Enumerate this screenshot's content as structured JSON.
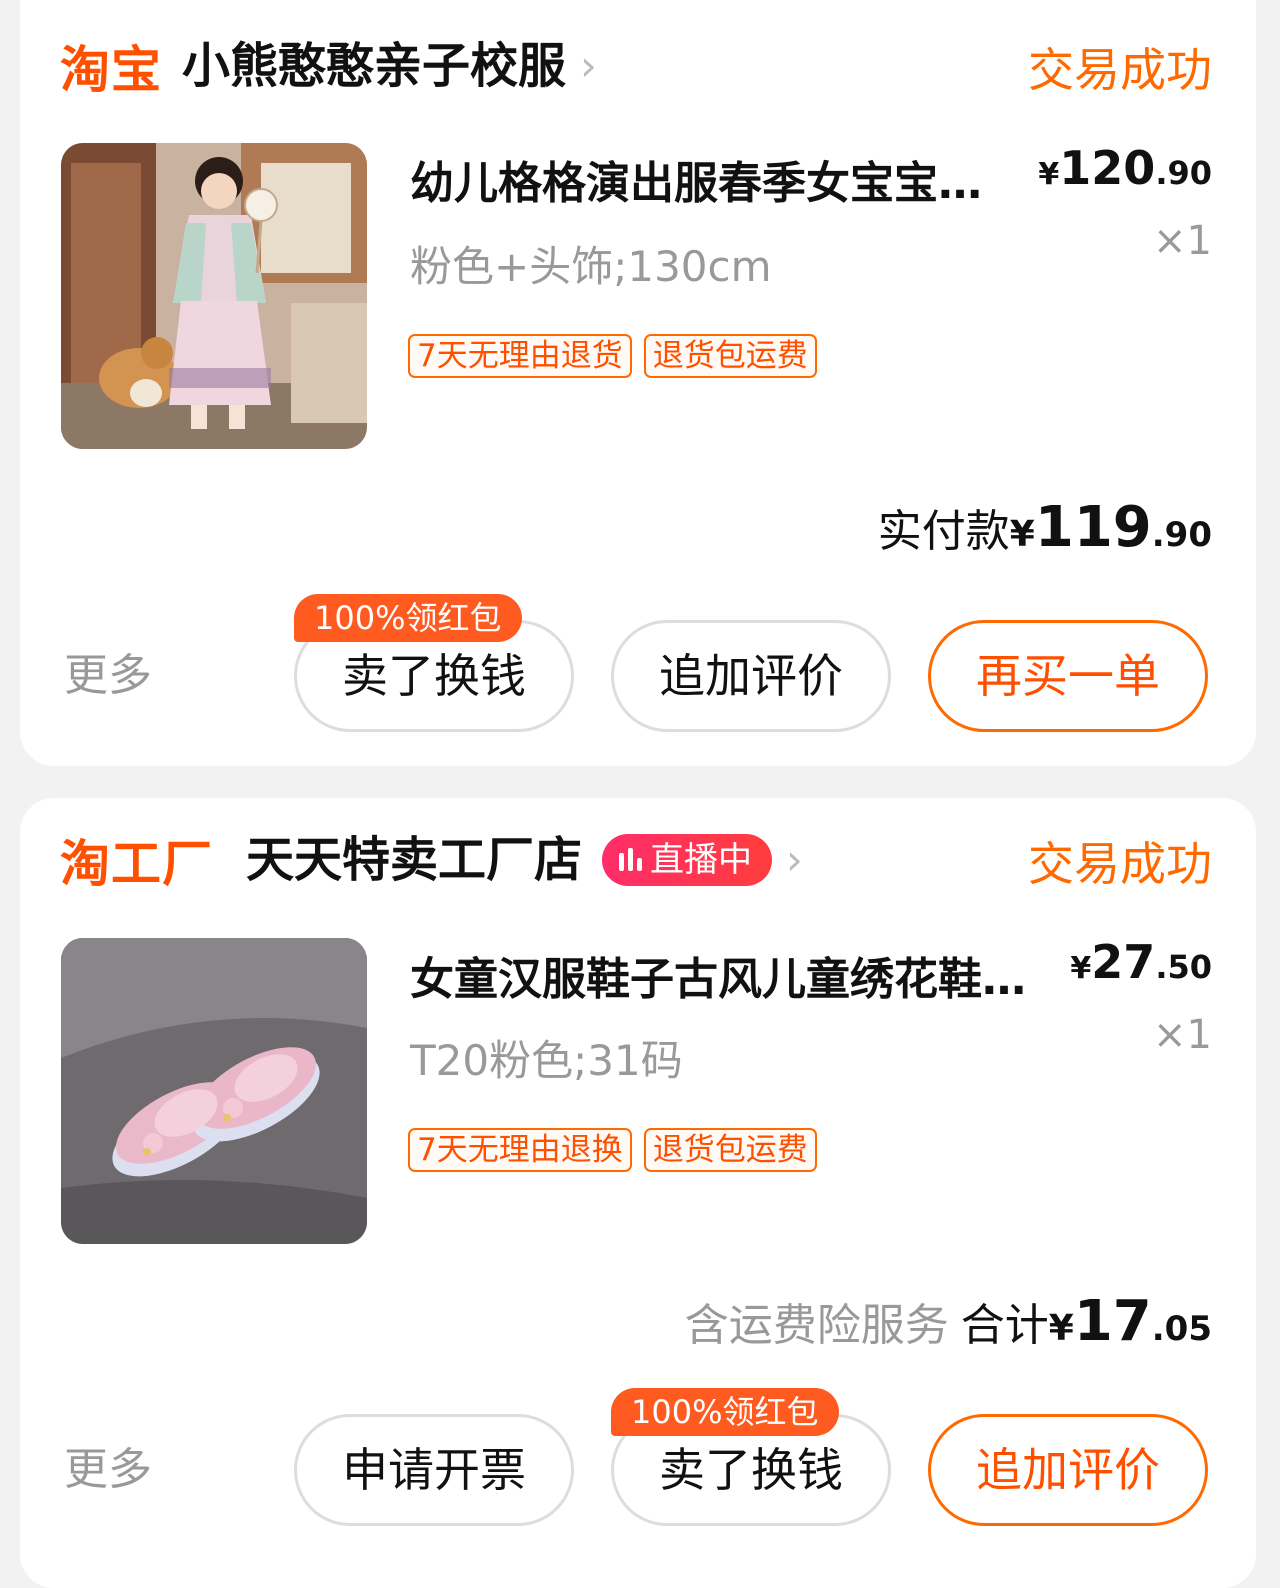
{
  "orders": [
    {
      "platform": "淘宝",
      "shop": "小熊憨憨亲子校服",
      "status": "交易成功",
      "item": {
        "title": "幼儿格格演出服春季女宝宝…",
        "sku": "粉色+头饰;130cm",
        "price_symbol": "¥",
        "price_int": "120",
        "price_dec": ".90",
        "qty": "×1",
        "tags": [
          "7天无理由退货",
          "退货包运费"
        ]
      },
      "total_label": "实付款",
      "total_symbol": "¥",
      "total_int": "119",
      "total_dec": ".90",
      "more": "更多",
      "badge": "100%领红包",
      "buttons": [
        "卖了换钱",
        "追加评价",
        "再买一单"
      ]
    },
    {
      "platform": "淘工厂",
      "shop": "天天特卖工厂店",
      "live_label": "直播中",
      "status": "交易成功",
      "item": {
        "title": "女童汉服鞋子古风儿童绣花鞋…",
        "sku": "T20粉色;31码",
        "price_symbol": "¥",
        "price_int": "27",
        "price_dec": ".50",
        "qty": "×1",
        "tags": [
          "7天无理由退换",
          "退货包运费"
        ]
      },
      "service_note": "含运费险服务",
      "total_label": "合计",
      "total_symbol": "¥",
      "total_int": "17",
      "total_dec": ".05",
      "more": "更多",
      "badge": "100%领红包",
      "buttons": [
        "申请开票",
        "卖了换钱",
        "追加评价"
      ]
    }
  ],
  "colors": {
    "accent": "#ff5000",
    "status": "#ff6a00",
    "live": "#ff2d6a"
  }
}
